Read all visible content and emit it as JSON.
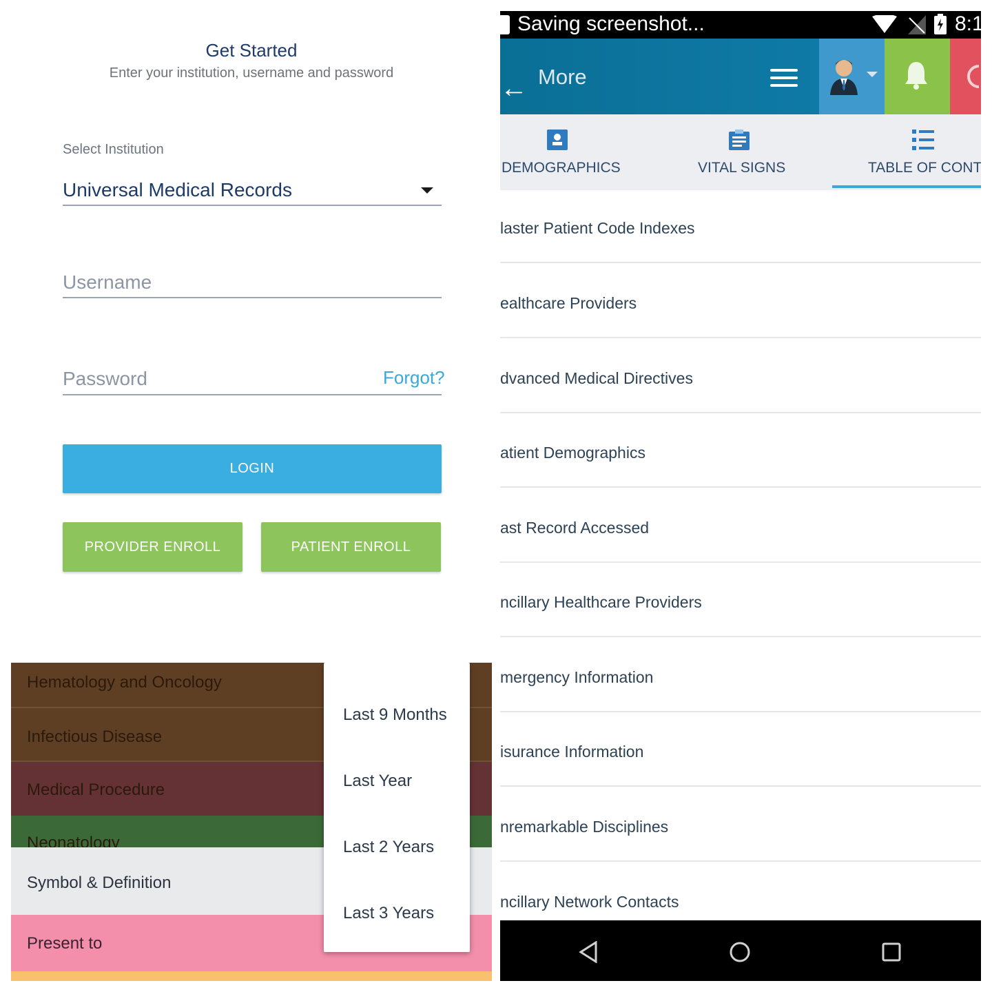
{
  "login": {
    "title": "Get Started",
    "subtitle": "Enter your institution, username and password",
    "institution_label": "Select Institution",
    "institution_value": "Universal Medical Records",
    "username_placeholder": "Username",
    "password_placeholder": "Password",
    "forgot": "Forgot?",
    "login_button": "LOGIN",
    "provider_enroll": "PROVIDER ENROLL",
    "patient_enroll": "PATIENT ENROLL"
  },
  "phone": {
    "status_text": "Saving screenshot...",
    "status_time": "8:1",
    "title": "More",
    "tabs": [
      {
        "label": "DEMOGRAPHICS",
        "icon": "id-card-icon"
      },
      {
        "label": "VITAL SIGNS",
        "icon": "clipboard-icon"
      },
      {
        "label": "TABLE OF CONT.",
        "icon": "list-icon"
      }
    ],
    "list": [
      "laster Patient Code Indexes",
      "ealthcare Providers",
      "dvanced Medical Directives",
      "atient Demographics",
      "ast Record Accessed",
      "ncillary Healthcare Providers",
      "mergency Information",
      "isurance Information",
      "nremarkable Disciplines",
      "ncillary Network Contacts"
    ],
    "colors": {
      "toolbar": "#127fb0",
      "user": "#3f99cc",
      "bell": "#8bc34a",
      "accent": "#39a9d9"
    }
  },
  "categories": {
    "rows": [
      {
        "label": "Hematology and Oncology",
        "color": "#5f3f24"
      },
      {
        "label": "Infectious Disease",
        "color": "#5f3f24"
      },
      {
        "label": "Medical Procedure",
        "color": "#643234"
      },
      {
        "label": "Neonatology",
        "color": "#3b6a38"
      },
      {
        "label": "Symbol & Definition",
        "color": "#e9eaec"
      },
      {
        "label": "Present to",
        "color": "#f38fab"
      }
    ],
    "popup": [
      "Last 9 Months",
      "Last Year",
      "Last 2 Years",
      "Last 3 Years"
    ]
  }
}
